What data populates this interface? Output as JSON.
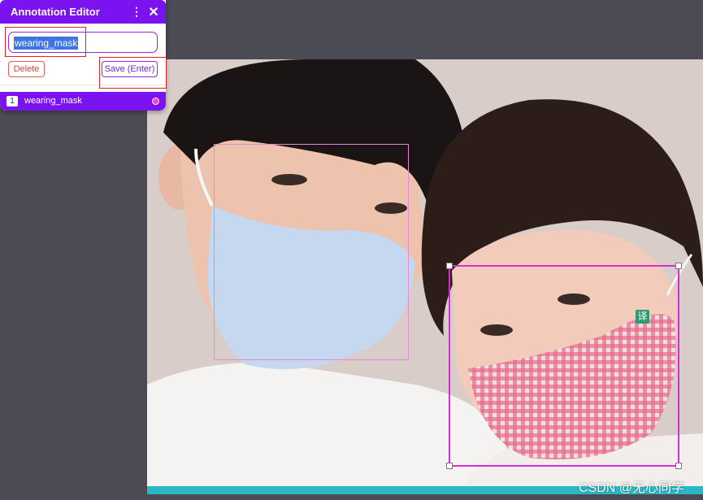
{
  "editor": {
    "title": "Annotation Editor",
    "menu_icon": "⋮",
    "close_icon": "✕",
    "label_value": "wearing_mask",
    "delete_label": "Delete",
    "save_label": "Save (Enter)"
  },
  "annotations": [
    {
      "index": "1",
      "label": "wearing_mask",
      "color": "#ff3fd1"
    }
  ],
  "translate_badge": "译",
  "watermark": "CSDN @无心同学",
  "colors": {
    "accent": "#7b12f0",
    "bbox_selected": "#d42fd6",
    "bbox_other": "#e58ad0",
    "highlight": "#e02424"
  }
}
